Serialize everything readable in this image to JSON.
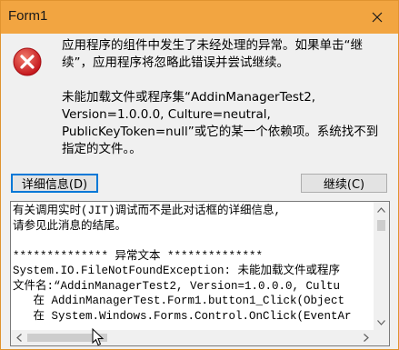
{
  "window": {
    "title": "Form1",
    "title_color": "#f2a541",
    "close_icon": "close-icon"
  },
  "message": {
    "icon": "error-icon",
    "line1": "应用程序的组件中发生了未经处理的异常。如果单击“继续”，应用程序将忽略此错误并尝试继续。",
    "line2": "未能加载文件或程序集“AddinManagerTest2, Version=1.0.0.0, Culture=neutral, PublicKeyToken=null”或它的某一个依赖项。系统找不到指定的文件。。"
  },
  "buttons": {
    "details_label": "详细信息(D)",
    "continue_label": "继续(C)"
  },
  "details": {
    "lines": [
      "有关调用实时(JIT)调试而不是此对话框的详细信息,",
      "请参见此消息的结尾。",
      "",
      "************** 异常文本 **************",
      "System.IO.FileNotFoundException: 未能加载文件或程序",
      "文件名:“AddinManagerTest2, Version=1.0.0.0, Cultu",
      "   在 AddinManagerTest.Form1.button1_Click(Object",
      "   在 System.Windows.Forms.Control.OnClick(EventAr"
    ]
  }
}
